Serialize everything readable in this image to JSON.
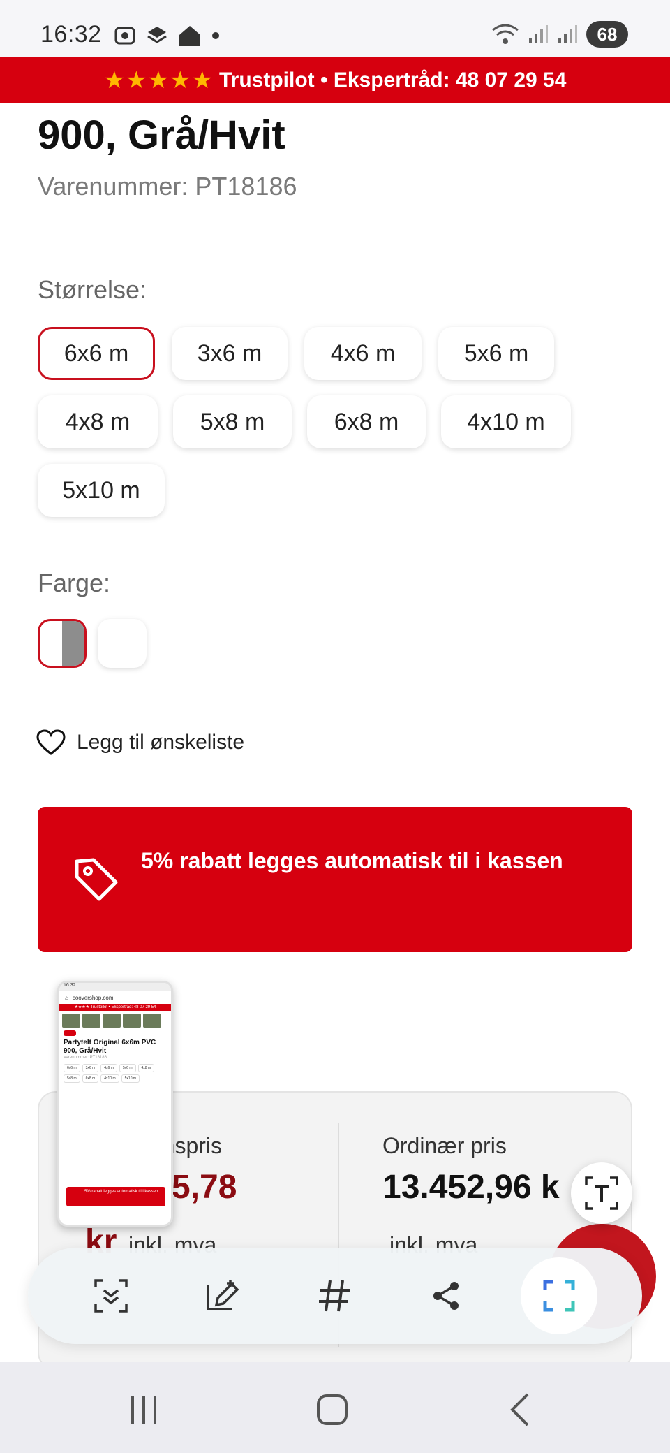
{
  "status_bar": {
    "time": "16:32",
    "battery": "68",
    "icons_left": [
      "screenshot-icon",
      "layers-icon",
      "home-icon",
      "dot-icon"
    ],
    "icons_right": [
      "wifi-icon",
      "signal-icon",
      "signal-icon-2",
      "battery-icon"
    ]
  },
  "trust_banner": {
    "stars": "★★★★★",
    "text": "Trustpilot • Ekspertråd: 48 07 29 54"
  },
  "product": {
    "title_fragment": "900, Grå/Hvit",
    "sku": "Varenummer: PT18186"
  },
  "size": {
    "label": "Størrelse:",
    "options": [
      "6x6 m",
      "3x6 m",
      "4x6 m",
      "5x6 m",
      "4x8 m",
      "5x8 m",
      "6x8 m",
      "4x10 m",
      "5x10 m"
    ],
    "selected": "6x6 m"
  },
  "color": {
    "label": "Farge:",
    "options": [
      {
        "name": "grå-hvit",
        "colors": [
          "#ffffff",
          "#8d8d8d"
        ],
        "selected": true
      },
      {
        "name": "hvit",
        "colors": [
          "#ffffff"
        ],
        "selected": false
      }
    ]
  },
  "wishlist": {
    "label": "Legg til ønskeliste"
  },
  "promo": {
    "text": "5% rabatt legges automatisk til i kassen",
    "icon": "tag-icon"
  },
  "price": {
    "campaign_label": "...nspris",
    "campaign_value": "...5,78",
    "campaign_unit": "kr",
    "campaign_note": "inkl. mva",
    "regular_label": "Ordinær pris",
    "regular_value": "13.452,96 k",
    "regular_note": "inkl. mva"
  },
  "thumbnail": {
    "time": "16:32",
    "url": "coovershop.com",
    "trust": "★★★★ Trustpilot • Ekspertråd: 48 07 29 54",
    "title": "Partytelt Original 6x6m PVC 900, Grå/Hvit",
    "sku": "Varenummer: PT18186",
    "sizes": [
      "6x6 m",
      "3x6 m",
      "4x6 m",
      "5x6 m",
      "4x8 m",
      "5x8 m",
      "6x8 m",
      "4x10 m",
      "5x10 m"
    ],
    "promo": "5% rabatt legges automatisk til i kassen"
  },
  "toolbar": {
    "items": [
      "scroll-capture-icon",
      "edit-icon",
      "hashtag-icon",
      "share-icon",
      "smart-select-icon"
    ]
  },
  "accent": "#d6000f"
}
